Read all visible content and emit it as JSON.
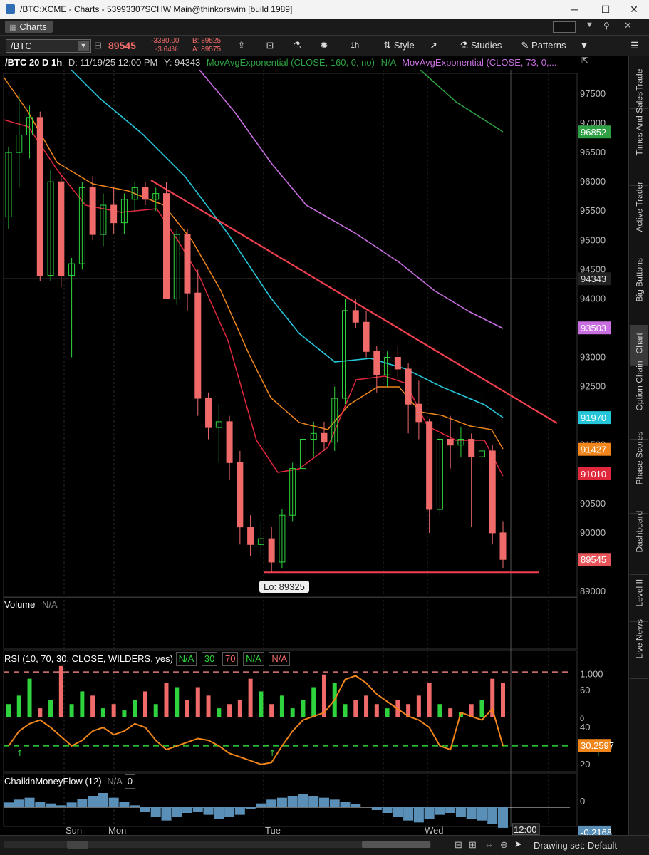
{
  "window": {
    "title": "/BTC:XCME - Charts - 53993307SCHW Main@thinkorswim [build 1989]",
    "minimize": "─",
    "maximize": "☐",
    "close": "✕"
  },
  "tab": {
    "label": "Charts"
  },
  "toolbar": {
    "symbol": "/BTC",
    "last": "89545",
    "change": "-3380.00",
    "change_pct": "-3.64%",
    "bid": "B: 89525",
    "ask": "A: 89575",
    "interval": "1h",
    "style": "Style",
    "studies": "Studies",
    "patterns": "Patterns"
  },
  "study_bar": {
    "symbol_period": "/BTC 20 D 1h",
    "date": "D: 11/19/25 12:00 PM",
    "y_readout": "Y: 94343",
    "ema160": "MovAvgExponential (CLOSE, 160, 0, no)",
    "ema160_value": "N/A",
    "ema73": "MovAvgExponential (CLOSE, 73, 0,..."
  },
  "right_nav": [
    "Trade",
    "Times And Sales",
    "Active Trader",
    "Big Buttons",
    "Chart",
    "Option Chain",
    "Phase Scores",
    "Dashboard",
    "Level II",
    "Live News"
  ],
  "price_axis": {
    "ticks": [
      "97500",
      "97000",
      "96500",
      "96000",
      "95500",
      "95000",
      "94500",
      "94000",
      "93500",
      "93000",
      "92500",
      "92000",
      "91500",
      "91000",
      "90500",
      "90000",
      "89000"
    ],
    "crosshair_label": "94343",
    "labels": [
      {
        "text": "96852",
        "color": "#2ea043"
      },
      {
        "text": "93503",
        "color": "#c86ee0"
      },
      {
        "text": "91970",
        "color": "#26c6da"
      },
      {
        "text": "91427",
        "color": "#f0861b"
      },
      {
        "text": "91010",
        "color": "#e0283c"
      },
      {
        "text": "89545",
        "color": "#e8555a"
      }
    ]
  },
  "lo_label": "Lo: 89325",
  "volume": {
    "title": "Volume",
    "value": "N/A",
    "tick": "1,000",
    "tick0": "0"
  },
  "rsi": {
    "title": "RSI (10, 70, 30, CLOSE, WILDERS, yes)",
    "values": [
      "N/A",
      "30",
      "70",
      "N/A",
      "N/A"
    ],
    "ticks": [
      "60",
      "40",
      "20"
    ],
    "current": "30.2597"
  },
  "cmf": {
    "title": "ChaikinMoneyFlow (12)",
    "value": "N/A",
    "zero": "0",
    "tick": "0",
    "current": "-0.2168"
  },
  "time_axis": {
    "labels": [
      "Sun",
      "Mon",
      "Tue",
      "Wed"
    ],
    "current": "12:00"
  },
  "bottom": {
    "drawing_set": "Drawing set: Default"
  },
  "colors": {
    "up": "#2ed33d",
    "down": "#f06a6a",
    "ema160": "#2ea043",
    "ema73": "#c86ee0",
    "cyan_ma": "#26c6da",
    "orange_ma": "#f0861b",
    "red_ma": "#e0283c",
    "trend": "#f04050"
  },
  "chart_data": {
    "type": "candlestick",
    "interval": "1h",
    "candles": [
      [
        95400,
        96600,
        95200,
        96500
      ],
      [
        96500,
        97500,
        95900,
        96800
      ],
      [
        96800,
        97300,
        96400,
        97100
      ],
      [
        97100,
        97200,
        94300,
        94400
      ],
      [
        94400,
        96200,
        94300,
        96000
      ],
      [
        96000,
        96100,
        94200,
        94400
      ],
      [
        94400,
        94700,
        93000,
        94600
      ],
      [
        94600,
        96000,
        94500,
        95900
      ],
      [
        95900,
        96100,
        95000,
        95100
      ],
      [
        95100,
        95800,
        94900,
        95600
      ],
      [
        95600,
        95900,
        95100,
        95300
      ],
      [
        95300,
        95800,
        95100,
        95700
      ],
      [
        95700,
        96000,
        95500,
        95900
      ],
      [
        95900,
        96000,
        95600,
        95700
      ],
      [
        95700,
        95900,
        95500,
        95800
      ],
      [
        95800,
        96000,
        94000,
        94000
      ],
      [
        94000,
        95200,
        93900,
        95100
      ],
      [
        95100,
        95200,
        93800,
        94100
      ],
      [
        94100,
        94500,
        92000,
        92300
      ],
      [
        92300,
        92400,
        91600,
        91800
      ],
      [
        91800,
        92200,
        91200,
        91900
      ],
      [
        91900,
        92000,
        90900,
        91200
      ],
      [
        91200,
        91400,
        89800,
        90100
      ],
      [
        90100,
        90300,
        89600,
        89800
      ],
      [
        89800,
        90200,
        89600,
        89900
      ],
      [
        89900,
        90100,
        89325,
        89500
      ],
      [
        89500,
        90400,
        89400,
        90300
      ],
      [
        90300,
        91200,
        90200,
        91100
      ],
      [
        91100,
        91700,
        91000,
        91600
      ],
      [
        91600,
        91900,
        91300,
        91700
      ],
      [
        91700,
        91900,
        91400,
        91550
      ],
      [
        91550,
        92500,
        91400,
        92300
      ],
      [
        92300,
        94000,
        92200,
        93800
      ],
      [
        93800,
        94000,
        93500,
        93600
      ],
      [
        93600,
        93800,
        93000,
        93100
      ],
      [
        93100,
        93200,
        92400,
        92700
      ],
      [
        92700,
        93100,
        92500,
        93000
      ],
      [
        93000,
        93200,
        92600,
        92800
      ],
      [
        92800,
        92900,
        91700,
        92200
      ],
      [
        92200,
        92600,
        91600,
        91900
      ],
      [
        91900,
        91950,
        90000,
        90400
      ],
      [
        90400,
        91700,
        90300,
        91600
      ],
      [
        91600,
        92000,
        91100,
        91500
      ],
      [
        91500,
        91800,
        91300,
        91600
      ],
      [
        91600,
        91700,
        90100,
        91300
      ],
      [
        91300,
        92400,
        91000,
        91400
      ],
      [
        91400,
        91500,
        89800,
        90000
      ],
      [
        90000,
        90200,
        89400,
        89545
      ]
    ],
    "overlays": [
      {
        "name": "MovAvgExponential (CLOSE, 160, 0, no)",
        "last": 96852
      },
      {
        "name": "MovAvgExponential (CLOSE, 73, 0,...",
        "last": 93503
      },
      {
        "last": 91970
      },
      {
        "last": 91427
      },
      {
        "last": 91010
      }
    ],
    "support_line": 89325,
    "y_range": [
      88950,
      97800
    ],
    "rsi": [
      30,
      38,
      42,
      44,
      40,
      35,
      30,
      33,
      38,
      40,
      36,
      38,
      42,
      40,
      33,
      28,
      30,
      32,
      34,
      33,
      30,
      26,
      24,
      22,
      20,
      21,
      30,
      38,
      44,
      46,
      48,
      55,
      66,
      68,
      64,
      58,
      54,
      50,
      46,
      44,
      40,
      30,
      28,
      48,
      46,
      44,
      50,
      30
    ],
    "rsi_range": [
      18,
      72
    ],
    "volume": [
      300,
      500,
      900,
      200,
      400,
      1200,
      300,
      600,
      500,
      200,
      300,
      150,
      400,
      600,
      300,
      800,
      700,
      400,
      700,
      500,
      200,
      300,
      400,
      900,
      600,
      300,
      500,
      200,
      400,
      700,
      1000,
      800,
      300,
      400,
      500,
      300,
      200,
      400,
      300,
      500,
      800,
      300,
      200,
      100,
      300,
      400,
      900,
      800
    ],
    "volume_range": [
      0,
      1400
    ],
    "cmf": [
      0.05,
      0.08,
      0.1,
      0.06,
      0.04,
      0.02,
      0.05,
      0.09,
      0.12,
      0.15,
      0.1,
      0.06,
      0.02,
      -0.05,
      -0.1,
      -0.14,
      -0.1,
      -0.06,
      -0.05,
      -0.08,
      -0.12,
      -0.1,
      -0.08,
      -0.02,
      0.04,
      0.08,
      0.1,
      0.12,
      0.14,
      0.12,
      0.1,
      0.08,
      0.06,
      0.03,
      0.0,
      -0.03,
      -0.06,
      -0.1,
      -0.14,
      -0.16,
      -0.12,
      -0.08,
      -0.06,
      -0.1,
      -0.12,
      -0.14,
      -0.18,
      -0.2168
    ],
    "cmf_range": [
      -0.3,
      0.3
    ]
  }
}
